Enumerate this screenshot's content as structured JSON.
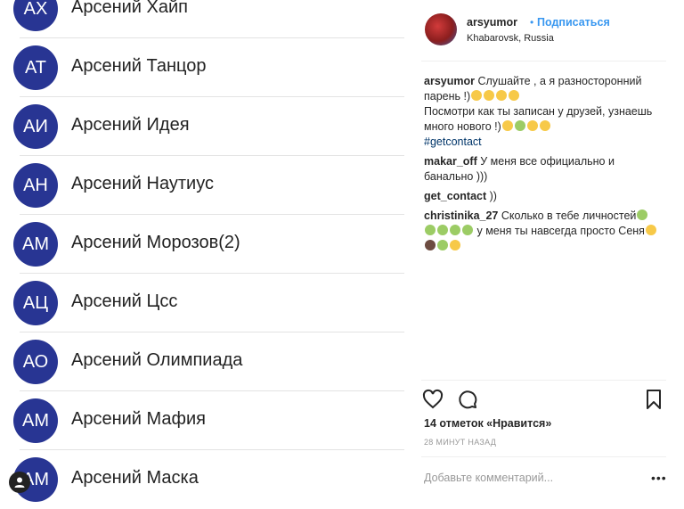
{
  "contacts": [
    {
      "initials": "АХ",
      "name": "Арсений Хайп"
    },
    {
      "initials": "АТ",
      "name": "Арсений Танцор"
    },
    {
      "initials": "АИ",
      "name": "Арсений Идея"
    },
    {
      "initials": "АН",
      "name": "Арсений Наутиус"
    },
    {
      "initials": "АМ",
      "name": "Арсений Морозов(2)"
    },
    {
      "initials": "АЦ",
      "name": "Арсений Цсс"
    },
    {
      "initials": "АО",
      "name": "Арсений Олимпиада"
    },
    {
      "initials": "АМ",
      "name": "Арсений Мафия"
    },
    {
      "initials": "АМ",
      "name": "Арсений Маска"
    }
  ],
  "post": {
    "username": "arsyumor",
    "separator": "•",
    "follow_label": "Подписаться",
    "location": "Khabarovsk, Russia",
    "caption": {
      "author": "arsyumor",
      "line1": "Слушайте , а я разносторонний парень !)",
      "line2": "Посмотри как ты записан у друзей, узнаешь много нового !)",
      "hashtag": "#getcontact"
    },
    "comments": [
      {
        "author": "makar_off",
        "text": "У меня все официально и банально )))"
      },
      {
        "author": "get_contact",
        "text": "))"
      },
      {
        "author": "christinika_27",
        "text1": "Сколько в тебе личностей",
        "text2": "у меня ты навсегда просто Сеня"
      }
    ],
    "likes": "14 отметок «Нравится»",
    "time": "28 МИНУТ НАЗАД",
    "comment_placeholder": "Добавьте комментарий...",
    "more_label": "•••"
  }
}
